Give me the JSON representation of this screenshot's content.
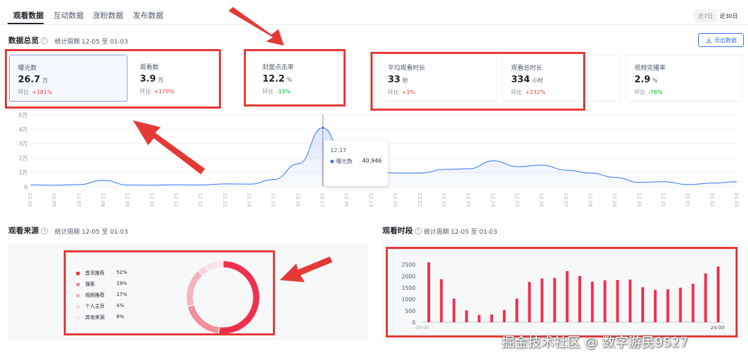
{
  "tabs": [
    {
      "label": "观看数据",
      "active": true
    },
    {
      "label": "互动数据",
      "active": false
    },
    {
      "label": "涨粉数据",
      "active": false
    },
    {
      "label": "发布数据",
      "active": false
    }
  ],
  "range_toggle": [
    {
      "label": "近7日",
      "active": false
    },
    {
      "label": "近30日",
      "active": true
    }
  ],
  "overview": {
    "title": "数据总览",
    "help_icon": "question-circle-icon",
    "period": "统计周期 12-05 至 01-03",
    "export_label": "导出数据",
    "export_icon": "download-icon"
  },
  "metrics": [
    {
      "label": "曝光数",
      "value": "26.7",
      "unit": "万",
      "compare_label": "环比",
      "delta": "+181%",
      "trend": "up"
    },
    {
      "label": "观看数",
      "value": "3.9",
      "unit": "万",
      "compare_label": "环比",
      "delta": "+179%",
      "trend": "up"
    },
    {
      "label": "封面点击率",
      "value": "12.2",
      "unit": "%",
      "compare_label": "环比",
      "delta": "-15%",
      "trend": "down"
    },
    {
      "label": "平均观看时长",
      "value": "33",
      "unit": "秒",
      "compare_label": "环比",
      "delta": "+1%",
      "trend": "up"
    },
    {
      "label": "观看总时长",
      "value": "334",
      "unit": "小时",
      "compare_label": "环比",
      "delta": "+232%",
      "trend": "up"
    },
    {
      "label": "视频完播率",
      "value": "2.9",
      "unit": "%",
      "compare_label": "环比",
      "delta": "-76%",
      "trend": "down"
    }
  ],
  "colors": {
    "accent": "#3370ff",
    "annotation": "#e53935",
    "bar": "#f0304e",
    "up": "#f53f3f",
    "down": "#00b42a"
  },
  "tooltip": {
    "date": "12.17",
    "series": "曝光数",
    "value": "40,946"
  },
  "sources": {
    "title": "观看来源",
    "period": "统计周期 12-05 至 01-03"
  },
  "time_slots": {
    "title": "观看时段",
    "period": "统计周期 12-05 至 01-03"
  },
  "watermark": "掘金技术社区 @ 数字游民9527",
  "chart_data": [
    {
      "type": "area",
      "y_ticks": [
        "0",
        "1万",
        "2万",
        "3万",
        "4万",
        "5万"
      ],
      "ylim": [
        0,
        50000
      ],
      "grid": true,
      "categories": [
        "12.05",
        "12.06",
        "12.07",
        "12.08",
        "12.09",
        "12.10",
        "12.11",
        "12.12",
        "12.13",
        "12.14",
        "12.15",
        "12.16",
        "12.17",
        "12.18",
        "12.19",
        "12.20",
        "12.21",
        "12.22",
        "12.23",
        "12.24",
        "12.25",
        "12.26",
        "12.27",
        "12.28",
        "12.29",
        "12.30",
        "12.31",
        "01.01",
        "01.02",
        "01.03"
      ],
      "series": [
        {
          "name": "曝光数",
          "values": [
            1300,
            1000,
            1500,
            4500,
            1200,
            1100,
            1300,
            1200,
            2000,
            1800,
            5000,
            16000,
            40946,
            14000,
            11000,
            9500,
            9500,
            12000,
            12500,
            18000,
            14000,
            15000,
            11500,
            9500,
            6500,
            3000,
            3500,
            1500,
            2500,
            3500
          ]
        }
      ],
      "highlight_index": 12
    },
    {
      "type": "pie",
      "categories": [
        "首页推荐",
        "搜索",
        "视频推荐",
        "个人主页",
        "其他来源"
      ],
      "values": [
        52,
        19,
        17,
        4,
        8
      ],
      "labels": [
        "52%",
        "19%",
        "17%",
        "4%",
        "8%"
      ],
      "colors": [
        "#f0304e",
        "#f2909d",
        "#f4b6be",
        "#f8d5da",
        "#fbe4e7"
      ],
      "legend": "left"
    },
    {
      "type": "bar",
      "y_ticks": [
        "0",
        "500",
        "1000",
        "1500",
        "2000",
        "2500"
      ],
      "ylim": [
        0,
        2700
      ],
      "x_labels": [
        "00:00",
        "24:00"
      ],
      "values": [
        2600,
        1870,
        1030,
        520,
        320,
        340,
        530,
        1030,
        1750,
        1900,
        1920,
        2220,
        2010,
        1760,
        1820,
        1830,
        1850,
        1520,
        1400,
        1430,
        1500,
        1670,
        2120,
        2420
      ]
    }
  ]
}
